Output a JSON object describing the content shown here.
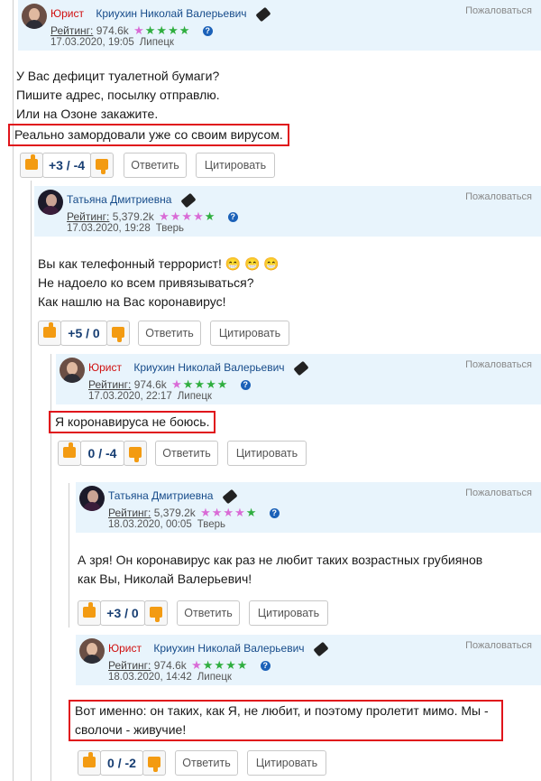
{
  "report_label": "Пожаловаться",
  "rating_label": "Рейтинг:",
  "reply_label": "Ответить",
  "quote_label": "Цитировать",
  "colors": {
    "star_purple": "#d96bd6",
    "star_green": "#2fae3f",
    "highlight": "#e0141b",
    "header_bg": "#e8f4fc"
  },
  "comments": [
    {
      "role": "Юрист",
      "name": "Криухин Николай Валерьевич",
      "rating": "974.6k",
      "stars": "1 purple, 4 green",
      "date": "17.03.2020, 19:05",
      "city": "Липецк",
      "lines": [
        "У Вас дефицит туалетной бумаги?",
        "Пишите адрес, посылку отправлю.",
        "Или на Озоне закажите."
      ],
      "highlight": "Реально замордовали уже со своим вирусом.",
      "score": "+3 / -4"
    },
    {
      "role": "",
      "name": "Татьяна Дмитриевна",
      "rating": "5,379.2k",
      "stars": "4 purple, 1 green",
      "date": "17.03.2020, 19:28",
      "city": "Тверь",
      "lines": [
        "Вы как телефонный террорист! 😁 😁 😁",
        "Не надоело ко всем привязываться?",
        "Как нашлю на Вас коронавирус!"
      ],
      "highlight": "",
      "score": "+5 / 0"
    },
    {
      "role": "Юрист",
      "name": "Криухин Николай Валерьевич",
      "rating": "974.6k",
      "stars": "1 purple, 4 green",
      "date": "17.03.2020, 22:17",
      "city": "Липецк",
      "lines": [],
      "highlight": "Я коронавируса не боюсь.",
      "score": "0 / -4"
    },
    {
      "role": "",
      "name": "Татьяна Дмитриевна",
      "rating": "5,379.2k",
      "stars": "4 purple, 1 green",
      "date": "18.03.2020, 00:05",
      "city": "Тверь",
      "lines": [
        "А зря! Он коронавирус как раз не любит таких возрастных грубиянов",
        "как Вы, Николай Валерьевич!"
      ],
      "highlight": "",
      "score": "+3 / 0"
    },
    {
      "role": "Юрист",
      "name": "Криухин Николай Валерьевич",
      "rating": "974.6k",
      "stars": "1 purple, 4 green",
      "date": "18.03.2020, 14:42",
      "city": "Липецк",
      "lines": [],
      "highlight": "Вот именно: он таких, как Я, не любит, и поэтому пролетит мимо. Мы - сволочи - живучие!",
      "highlight_lines": [
        "Вот именно: он таких, как Я, не любит, и поэтому пролетит мимо. Мы -",
        "сволочи - живучие!"
      ],
      "score": "0 / -2"
    }
  ]
}
